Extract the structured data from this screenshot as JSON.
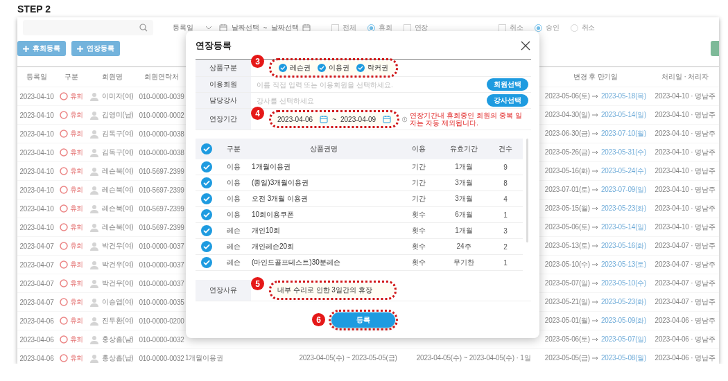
{
  "step_title": "STEP 2",
  "filter_bar": {
    "date_type": "등록일",
    "date_from": "날짜선택",
    "date_separator": "~",
    "date_to": "날짜선택",
    "options": [
      {
        "kind": "checkbox",
        "label": "전체",
        "checked": false
      },
      {
        "kind": "radio",
        "label": "휴회",
        "checked": true
      },
      {
        "kind": "checkbox",
        "label": "연장",
        "checked": false
      },
      {
        "kind": "checkbox",
        "label": "취소",
        "checked": false
      },
      {
        "kind": "radio",
        "label": "승인",
        "checked": true
      },
      {
        "kind": "radio",
        "label": "취소",
        "checked": false
      }
    ]
  },
  "action_buttons": [
    {
      "label": "휴회등록"
    },
    {
      "label": "연장등록"
    }
  ],
  "table": {
    "columns": [
      "등록일",
      "구분",
      "회원명",
      "회원연락처",
      "변경 후 만기일",
      "처리일 · 처리자"
    ],
    "rows": [
      {
        "date": "2023-04-10",
        "type": "휴회",
        "name": "이미자(여)",
        "phone": "010-0000-0039",
        "expiry_before": "2023-05-06(토)",
        "expiry_after": "2023-05-18(목)",
        "processed": "2023-04-10 · 명남주"
      },
      {
        "date": "2023-04-10",
        "type": "휴회",
        "name": "김영미(남)",
        "phone": "010-0000-0002",
        "expiry_before": "2023-04-30(일)",
        "expiry_after": "2023-05-14(일)",
        "processed": "2023-04-10 · 명남주"
      },
      {
        "date": "2023-04-10",
        "type": "휴회",
        "name": "김독구(여)",
        "phone": "010-0000-0038",
        "expiry_before": "2023-06-30(금)",
        "expiry_after": "2023-07-10(월)",
        "processed": "2023-04-10 · 명남주"
      },
      {
        "date": "2023-04-10",
        "type": "휴회",
        "name": "김독구(여)",
        "phone": "010-0000-0038",
        "expiry_before": "2023-05-26(금)",
        "expiry_after": "2023-05-31(수)",
        "processed": "2023-04-10 · 명남주"
      },
      {
        "date": "2023-04-10",
        "type": "휴회",
        "name": "레슨북(여)",
        "phone": "010-5697-2399",
        "expiry_before": "2023-05-16(화)",
        "expiry_after": "2023-05-24(수)",
        "processed": "2023-04-10 · 명남주"
      },
      {
        "date": "2023-04-10",
        "type": "휴회",
        "name": "레슨북(여)",
        "phone": "010-5697-2399",
        "expiry_before": "2023-07-01(토)",
        "expiry_after": "2023-07-09(일)",
        "processed": "2023-04-10 · 명남주"
      },
      {
        "date": "2023-04-10",
        "type": "휴회",
        "name": "레슨북(여)",
        "phone": "010-5697-2399",
        "expiry_before": "2023-05-15(월)",
        "expiry_after": "2023-05-23(화)",
        "processed": "2023-04-10 · 명남주"
      },
      {
        "date": "2023-04-10",
        "type": "휴회",
        "name": "레슨북(여)",
        "phone": "010-5697-2399",
        "expiry_before": "2023-05-06(토)",
        "expiry_after": "2023-05-14(일)",
        "processed": "2023-04-10 · 명남주"
      },
      {
        "date": "2023-04-07",
        "type": "휴회",
        "name": "박건우(여)",
        "phone": "010-0000-0037",
        "expiry_before": "2023-05-13(토)",
        "expiry_after": "2023-05-16(화)",
        "processed": "2023-04-07 · 명남주"
      },
      {
        "date": "2023-04-07",
        "type": "휴회",
        "name": "박건우(여)",
        "phone": "010-0000-0037",
        "expiry_before": "2023-05-10(수)",
        "expiry_after": "2023-05-13(토)",
        "processed": "2023-04-07 · 명남주"
      },
      {
        "date": "2023-04-07",
        "type": "휴회",
        "name": "박건우(여)",
        "phone": "010-0000-0037",
        "expiry_before": "2023-05-07(일)",
        "expiry_after": "2023-05-10(수)",
        "processed": "2023-04-07 · 명남주"
      },
      {
        "date": "2023-04-07",
        "type": "휴회",
        "name": "이승엽(여)",
        "phone": "010-0000-0035",
        "expiry_before": "2023-05-21(일)",
        "expiry_after": "2023-05-23(화)",
        "processed": "2023-04-07 · 명남주"
      },
      {
        "date": "2023-04-06",
        "type": "휴회",
        "name": "진두환(여)",
        "phone": "010-0000-0200",
        "expiry_before": "2023-05-01(월)",
        "expiry_after": "2023-05-09(화)",
        "processed": "2023-04-06 · 명남주"
      },
      {
        "date": "2023-04-06",
        "type": "휴회",
        "name": "홍상흠(남)",
        "phone": "010-0000-0032",
        "expiry_before": "2023-05-06(토)",
        "expiry_after": "2023-05-07(일)",
        "processed": "2023-04-06 · 명남주"
      },
      {
        "date": "2023-04-06",
        "type": "휴회",
        "name": "홍상흠(남)",
        "phone": "010-0000-0032",
        "expiry_before": "2023-05-05(금)",
        "expiry_after": "2023-05-08(월)",
        "processed": "2023-04-06 · 명남주",
        "product": "1개월이용권",
        "period": "2023-04-05(수) ~ 2023-05-05(금)",
        "pause": "2023-04-05(수) ~ 2023-04-05(수) · 1일"
      }
    ]
  },
  "modal": {
    "title": "연장등록",
    "product_type": {
      "label": "상품구분",
      "marker": "3",
      "options": [
        {
          "label": "레슨권",
          "checked": true
        },
        {
          "label": "이용권",
          "checked": true
        },
        {
          "label": "락커권",
          "checked": true
        }
      ]
    },
    "member": {
      "label": "이용회원",
      "placeholder": "이름 직접 입력 또는 이용회원을 선택하세요.",
      "button": "회원선택"
    },
    "instructor": {
      "label": "담당강사",
      "placeholder": "강사를 선택하세요",
      "button": "강사선택"
    },
    "period": {
      "label": "연장기간",
      "marker": "4",
      "from": "2023-04-06",
      "separator": "~",
      "to": "2023-04-09",
      "notice": "연장기간내 휴회중인 회원의 중복 일자는 자동 제외됩니다."
    },
    "products": {
      "all_checked": true,
      "columns": [
        "구분",
        "상품권명",
        "이용",
        "유효기간",
        "건수"
      ],
      "rows": [
        {
          "checked": true,
          "category": "이용",
          "name": "1개월이용권",
          "usage": "기간",
          "validity": "1개월",
          "count": "9"
        },
        {
          "checked": true,
          "category": "이용",
          "name": "(종일)3개월이용권",
          "usage": "기간",
          "validity": "3개월",
          "count": "8"
        },
        {
          "checked": true,
          "category": "이용",
          "name": "오전 3개월 이용권",
          "usage": "기간",
          "validity": "3개월",
          "count": "4"
        },
        {
          "checked": true,
          "category": "이용",
          "name": "10회이용쿠폰",
          "usage": "횟수",
          "validity": "6개월",
          "count": "1"
        },
        {
          "checked": true,
          "category": "레슨",
          "name": "개인10회",
          "usage": "횟수",
          "validity": "1개월",
          "count": "3"
        },
        {
          "checked": true,
          "category": "레슨",
          "name": "개인레슨20회",
          "usage": "횟수",
          "validity": "24주",
          "count": "2"
        },
        {
          "checked": true,
          "category": "레슨",
          "name": "(마인드골프테스트)30분레슨",
          "usage": "횟수",
          "validity": "무기한",
          "count": "1"
        }
      ]
    },
    "reason": {
      "label": "연장사유",
      "marker": "5",
      "value": "내부 수리로 인한 3일간의 휴장"
    },
    "submit": {
      "label": "등록",
      "marker": "6"
    }
  }
}
